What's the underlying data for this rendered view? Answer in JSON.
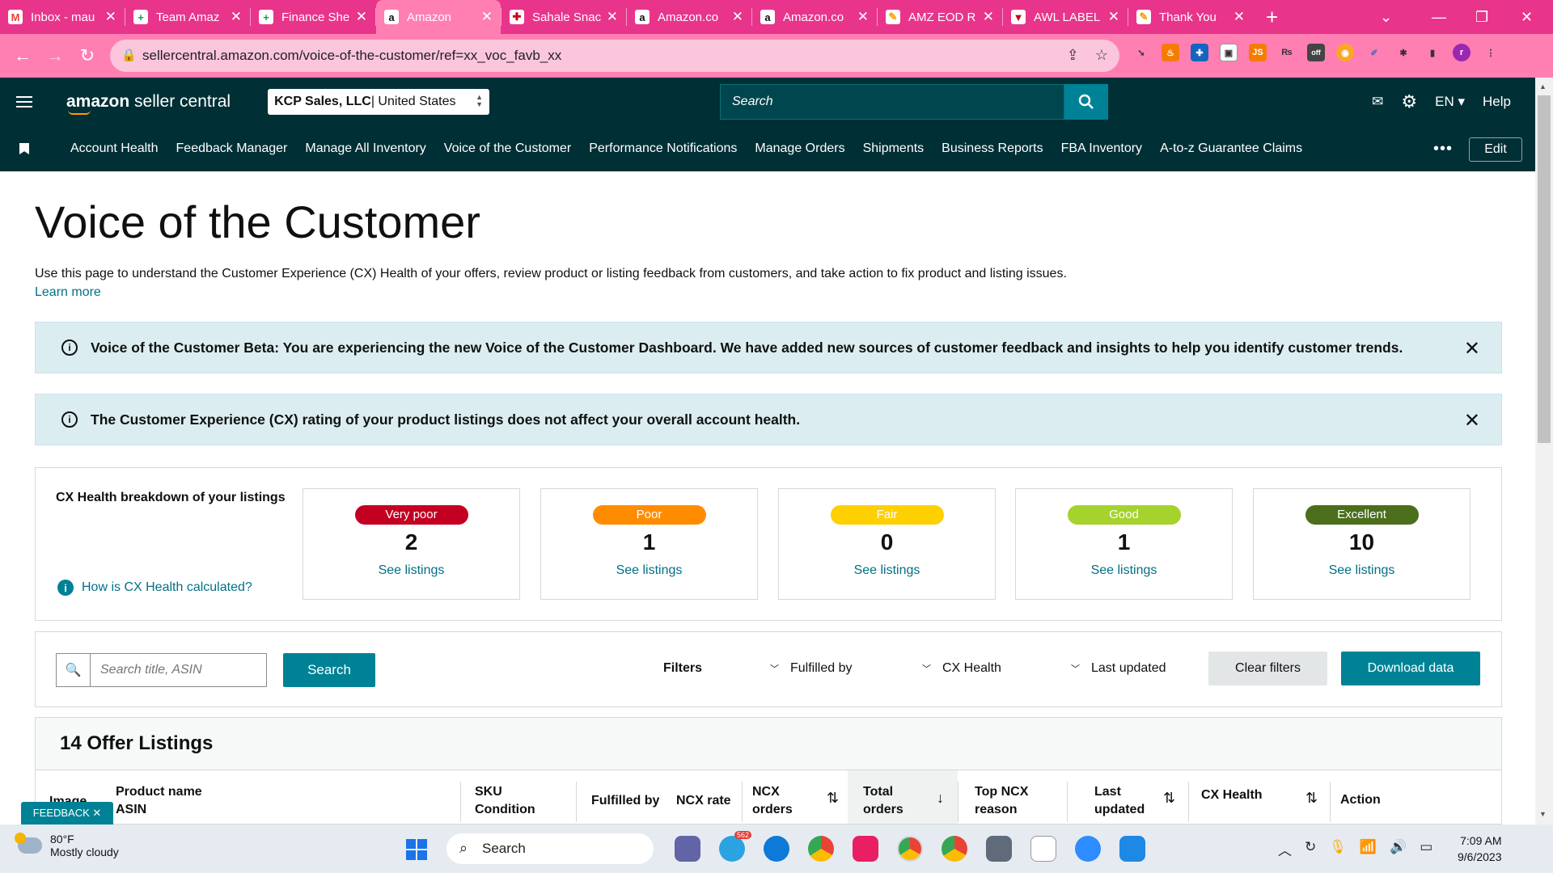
{
  "browser": {
    "tabs": [
      {
        "title": "Inbox - mau",
        "favicon": "gmail-icon",
        "color": "#ea4335",
        "glyph": "M"
      },
      {
        "title": "Team Amaz",
        "favicon": "sheets-icon",
        "color": "#0f9d58",
        "glyph": "+"
      },
      {
        "title": "Finance She",
        "favicon": "sheets-icon",
        "color": "#0f9d58",
        "glyph": "+"
      },
      {
        "title": "Amazon",
        "favicon": "amazon-icon",
        "color": "#111111",
        "glyph": "a",
        "active": true
      },
      {
        "title": "Sahale Snac",
        "favicon": "sahale-icon",
        "color": "#d0021b",
        "glyph": "✚"
      },
      {
        "title": "Amazon.co",
        "favicon": "amazon-icon",
        "color": "#111111",
        "glyph": "a"
      },
      {
        "title": "Amazon.co",
        "favicon": "amazon-icon",
        "color": "#111111",
        "glyph": "a"
      },
      {
        "title": "AMZ EOD R",
        "favicon": "pencil-icon",
        "color": "#f4a300",
        "glyph": "✎"
      },
      {
        "title": "AWL LABEL",
        "favicon": "shield-icon",
        "color": "#c4001a",
        "glyph": "▼"
      },
      {
        "title": "Thank You",
        "favicon": "pencil-icon",
        "color": "#f4a300",
        "glyph": "✎"
      }
    ],
    "url": "sellercentral.amazon.com/voice-of-the-customer/ref=xx_voc_favb_xx",
    "profile_initial": "r"
  },
  "header": {
    "logo_brand": "amazon",
    "logo_suffix": " seller central",
    "account_name": "KCP Sales, LLC",
    "account_region": " | United States",
    "search_placeholder": "Search",
    "language": "EN",
    "help": "Help"
  },
  "nav": {
    "items": [
      "Account Health",
      "Feedback Manager",
      "Manage All Inventory",
      "Voice of the Customer",
      "Performance Notifications",
      "Manage Orders",
      "Shipments",
      "Business Reports",
      "FBA Inventory",
      "A-to-z Guarantee Claims"
    ],
    "more": "•••",
    "edit": "Edit"
  },
  "page": {
    "title": "Voice of the Customer",
    "intro": "Use this page to understand the Customer Experience (CX) Health of your offers, review product or listing feedback from customers, and take action to fix product and listing issues.",
    "learn_more": "Learn more"
  },
  "banners": [
    {
      "text": "Voice of the Customer Beta: You are experiencing the new Voice of the Customer Dashboard. We have added new sources of customer feedback and insights to help you identify customer trends."
    },
    {
      "text": "The Customer Experience (CX) rating of your product listings does not affect your overall account health."
    }
  ],
  "cx_health": {
    "title": "CX Health breakdown of your listings",
    "help_link": "How is CX Health calculated?",
    "see_label": "See listings",
    "categories": [
      {
        "label": "Very poor",
        "count": "2",
        "color": "#c40022",
        "text_color": "#ffffff"
      },
      {
        "label": "Poor",
        "count": "1",
        "color": "#ff8c00",
        "text_color": "#ffffff"
      },
      {
        "label": "Fair",
        "count": "0",
        "color": "#ffd000",
        "text_color": "#ffffff"
      },
      {
        "label": "Good",
        "count": "1",
        "color": "#a5d22d",
        "text_color": "#ffffff"
      },
      {
        "label": "Excellent",
        "count": "10",
        "color": "#4b6e1c",
        "text_color": "#ffffff"
      }
    ]
  },
  "filters": {
    "search_placeholder": "Search title, ASIN",
    "search_button": "Search",
    "label": "Filters",
    "dropdowns": [
      "Fulfilled by",
      "CX Health",
      "Last updated"
    ],
    "clear": "Clear filters",
    "download": "Download data"
  },
  "listings": {
    "title": "14 Offer Listings",
    "columns": {
      "image": "Image",
      "product_name": "Product name",
      "asin": "ASIN",
      "sku": "SKU",
      "condition": "Condition",
      "fulfilled_by": "Fulfilled by",
      "ncx_rate": "NCX rate",
      "ncx_orders_1": "NCX",
      "ncx_orders_2": "orders",
      "total_orders_1": "Total",
      "total_orders_2": "orders",
      "top_ncx_1": "Top NCX",
      "top_ncx_2": "reason",
      "last_updated_1": "Last",
      "last_updated_2": "updated",
      "cx_health": "CX Health",
      "action": "Action"
    }
  },
  "feedback_tab": "FEEDBACK ✕",
  "taskbar": {
    "temperature": "80°F",
    "weather": "Mostly cloudy",
    "search": "Search",
    "time": "7:09 AM",
    "date": "9/6/2023",
    "telegram_badge": "562"
  }
}
